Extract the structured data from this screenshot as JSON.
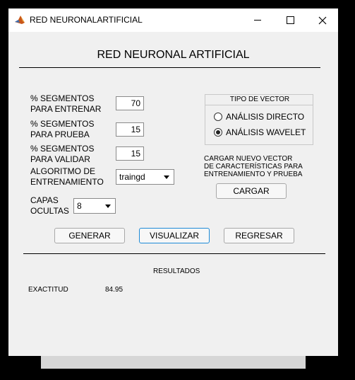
{
  "window": {
    "title": "RED NEURONALARTIFICIAL"
  },
  "heading": "RED NEURONAL ARTIFICIAL",
  "fields": [
    {
      "label_l1": "% SEGMENTOS",
      "label_l2": "PARA ENTRENAR",
      "value": "70"
    },
    {
      "label_l1": "% SEGMENTOS",
      "label_l2": "PARA PRUEBA",
      "value": "15"
    },
    {
      "label_l1": "% SEGMENTOS",
      "label_l2": "PARA VALIDAR",
      "value": "15"
    }
  ],
  "algorithm": {
    "label_l1": "ALGORITMO DE",
    "label_l2": "ENTRENAMIENTO",
    "selected": "traingd"
  },
  "layers": {
    "label_l1": "CAPAS",
    "label_l2": "OCULTAS",
    "selected": "8"
  },
  "vector_type": {
    "title": "TIPO DE VECTOR",
    "options": [
      {
        "label": "ANÁLISIS DIRECTO",
        "selected": false
      },
      {
        "label": "ANÁLISIS WAVELET",
        "selected": true
      }
    ]
  },
  "load": {
    "text_l1": "CARGAR NUEVO VECTOR",
    "text_l2": "DE CARACTERÍSTICAS PARA",
    "text_l3": "ENTRENAMIENTO Y PRUEBA",
    "button": "CARGAR"
  },
  "actions": {
    "generate": "GENERAR",
    "visualize": "VISUALIZAR",
    "back": "REGRESAR"
  },
  "results": {
    "title": "RESULTADOS",
    "accuracy_label": "EXACTITUD",
    "accuracy_value": "84.95"
  }
}
